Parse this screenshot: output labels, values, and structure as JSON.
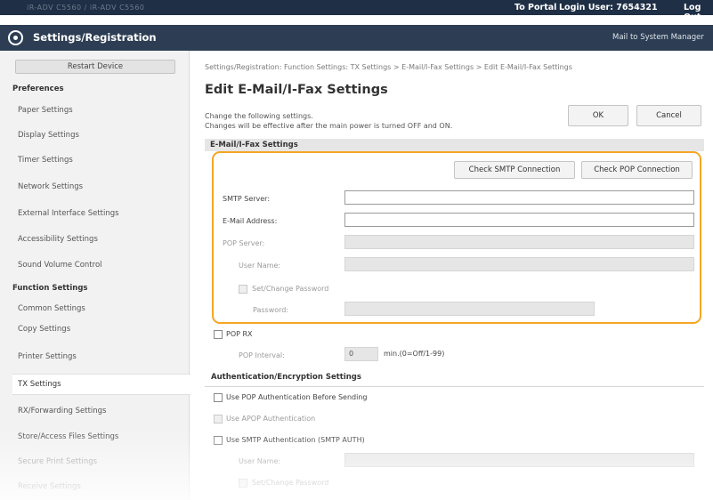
{
  "topbar": {
    "device_name": "iR-ADV C5560 / iR-ADV C5560",
    "portal_link": "To Portal",
    "login_user": "Login User:  7654321",
    "logout": "Log Out"
  },
  "titlebar": {
    "title": "Settings/Registration",
    "mail_link": "Mail to System Manager"
  },
  "sidebar": {
    "restart_button": "Restart Device",
    "preferences_heading": "Preferences",
    "preferences_items": [
      "Paper Settings",
      "Display Settings",
      "Timer Settings",
      "Network Settings",
      "External Interface Settings",
      "Accessibility Settings",
      "Sound Volume Control"
    ],
    "function_heading": "Function Settings",
    "function_items": [
      "Common Settings",
      "Copy Settings",
      "Printer Settings",
      "TX Settings",
      "RX/Forwarding Settings",
      "Store/Access Files Settings",
      "Secure Print Settings",
      "Receive Settings"
    ],
    "active_item": "TX Settings"
  },
  "main": {
    "breadcrumb": "Settings/Registration: Function Settings: TX Settings > E-Mail/I-Fax Settings > Edit E-Mail/I-Fax Settings",
    "page_title": "Edit E-Mail/I-Fax Settings",
    "instruction_line1": "Change the following settings.",
    "instruction_line2": "Changes will be effective after the main power is turned OFF and ON.",
    "ok_button": "OK",
    "cancel_button": "Cancel",
    "section1_title": "E-Mail/I-Fax Settings",
    "check_smtp_button": "Check SMTP Connection",
    "check_pop_button": "Check POP Connection",
    "smtp_server_label": "SMTP Server:",
    "smtp_server_value": "",
    "email_address_label": "E-Mail Address:",
    "email_address_value": "",
    "pop_server_label": "POP Server:",
    "user_name_label": "User Name:",
    "set_change_password_label": "Set/Change Password",
    "password_label": "Password:",
    "pop_rx_label": "POP RX",
    "pop_interval_label": "POP Interval:",
    "pop_interval_value": "0",
    "pop_interval_unit": "min.(0=Off/1-99)",
    "section2_title": "Authentication/Encryption Settings",
    "use_pop_auth_label": "Use POP Authentication Before Sending",
    "use_apop_label": "Use APOP Authentication",
    "use_smtp_auth_label": "Use SMTP Authentication (SMTP AUTH)",
    "smtp_user_name_label": "User Name:",
    "smtp_set_change_password_label": "Set/Change Password"
  },
  "colors": {
    "highlight": "#f5a623",
    "topbar": "#1f2f45",
    "titlebar": "#2d3e54"
  }
}
